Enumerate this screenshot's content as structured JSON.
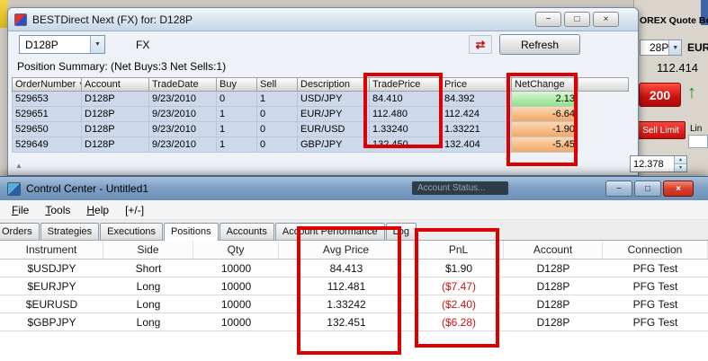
{
  "colors": {
    "annotation_red": "#dd0000",
    "net_change_positive": "#8fe08b",
    "net_change_negative": "#f2a765",
    "pnl_negative_text": "#cc1111",
    "trade_button_red": "#cc0f0f"
  },
  "icons": {
    "minimize": "−",
    "maximize": "□",
    "close": "×",
    "dropdown": "▼",
    "sort_desc": "▼",
    "up_arrow": "↑",
    "spin_up": "▲",
    "spin_down": "▼",
    "disconnect": "⇄"
  },
  "best_window": {
    "title": "BESTDirect Next (FX) for: D128P",
    "account_dropdown": "D128P",
    "fx_label": "FX",
    "refresh_button": "Refresh",
    "position_summary": "Position Summary: (Net Buys:3  Net Sells:1)",
    "table": {
      "headers": [
        "OrderNumber",
        "Account",
        "TradeDate",
        "Buy",
        "Sell",
        "Description",
        "TradePrice",
        "Price",
        "NetChange"
      ],
      "rows": [
        {
          "order_number": "529653",
          "account": "D128P",
          "trade_date": "9/23/2010",
          "buy": "0",
          "sell": "1",
          "description": "USD/JPY",
          "trade_price": "84.410",
          "price": "84.392",
          "net_change": "2.13"
        },
        {
          "order_number": "529651",
          "account": "D128P",
          "trade_date": "9/23/2010",
          "buy": "1",
          "sell": "0",
          "description": "EUR/JPY",
          "trade_price": "112.480",
          "price": "112.424",
          "net_change": "-6.64"
        },
        {
          "order_number": "529650",
          "account": "D128P",
          "trade_date": "9/23/2010",
          "buy": "1",
          "sell": "0",
          "description": "EUR/USD",
          "trade_price": "1.33240",
          "price": "1.33221",
          "net_change": "-1.90"
        },
        {
          "order_number": "529649",
          "account": "D128P",
          "trade_date": "9/23/2010",
          "buy": "1",
          "sell": "0",
          "description": "GBP/JPY",
          "trade_price": "132.450",
          "price": "132.404",
          "net_change": "-5.45"
        }
      ]
    }
  },
  "quote_board": {
    "title": "OREX Quote Board",
    "account_dropdown": "28P",
    "pair": "EUR",
    "price": "112.414",
    "size_button": "200",
    "sell_limit_button": "Sell Limit",
    "limit_label": "Lin",
    "limit_price": "12.378"
  },
  "control_center": {
    "title": "Control Center - Untitled1",
    "account_status": "Account Status...",
    "menu_items": [
      "File",
      "Tools",
      "Help",
      "[+/-]"
    ],
    "tabs": [
      "Orders",
      "Strategies",
      "Executions",
      "Positions",
      "Accounts",
      "Account Performance",
      "Log"
    ],
    "active_tab": "Positions",
    "table": {
      "headers": [
        "Instrument",
        "Side",
        "Qty",
        "Avg Price",
        "PnL",
        "Account",
        "Connection"
      ],
      "rows": [
        {
          "instrument": "$USDJPY",
          "side": "Short",
          "qty": "10000",
          "avg_price": "84.413",
          "pnl": "$1.90",
          "account": "D128P",
          "connection": "PFG Test"
        },
        {
          "instrument": "$EURJPY",
          "side": "Long",
          "qty": "10000",
          "avg_price": "112.481",
          "pnl": "($7.47)",
          "account": "D128P",
          "connection": "PFG Test"
        },
        {
          "instrument": "$EURUSD",
          "side": "Long",
          "qty": "10000",
          "avg_price": "1.33242",
          "pnl": "($2.40)",
          "account": "D128P",
          "connection": "PFG Test"
        },
        {
          "instrument": "$GBPJPY",
          "side": "Long",
          "qty": "10000",
          "avg_price": "132.451",
          "pnl": "($6.28)",
          "account": "D128P",
          "connection": "PFG Test"
        }
      ]
    }
  }
}
